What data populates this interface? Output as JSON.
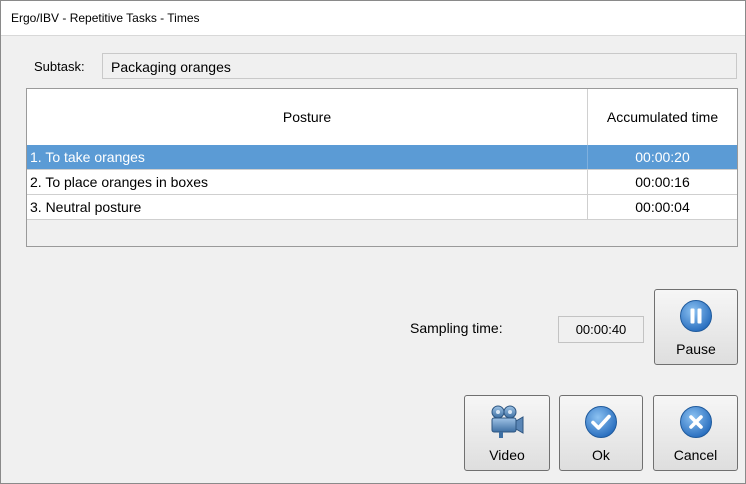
{
  "window": {
    "title": "Ergo/IBV - Repetitive Tasks - Times"
  },
  "subtask": {
    "label": "Subtask:",
    "value": "Packaging oranges"
  },
  "grid": {
    "columns": [
      "Posture",
      "Accumulated time"
    ],
    "rows": [
      {
        "posture": "1. To take oranges",
        "time": "00:00:20",
        "selected": true
      },
      {
        "posture": "2. To place oranges in boxes",
        "time": "00:00:16",
        "selected": false
      },
      {
        "posture": "3. Neutral posture",
        "time": "00:00:04",
        "selected": false
      }
    ]
  },
  "sampling": {
    "label": "Sampling time:",
    "value": "00:00:40"
  },
  "buttons": {
    "pause": {
      "label": "Pause",
      "icon": "pause-icon"
    },
    "video": {
      "label": "Video",
      "icon": "video-camera-icon"
    },
    "ok": {
      "label": "Ok",
      "icon": "checkmark-icon"
    },
    "cancel": {
      "label": "Cancel",
      "icon": "close-icon"
    }
  },
  "colors": {
    "selection": "#5b9bd5",
    "icon_blue": "#2f78c4"
  }
}
